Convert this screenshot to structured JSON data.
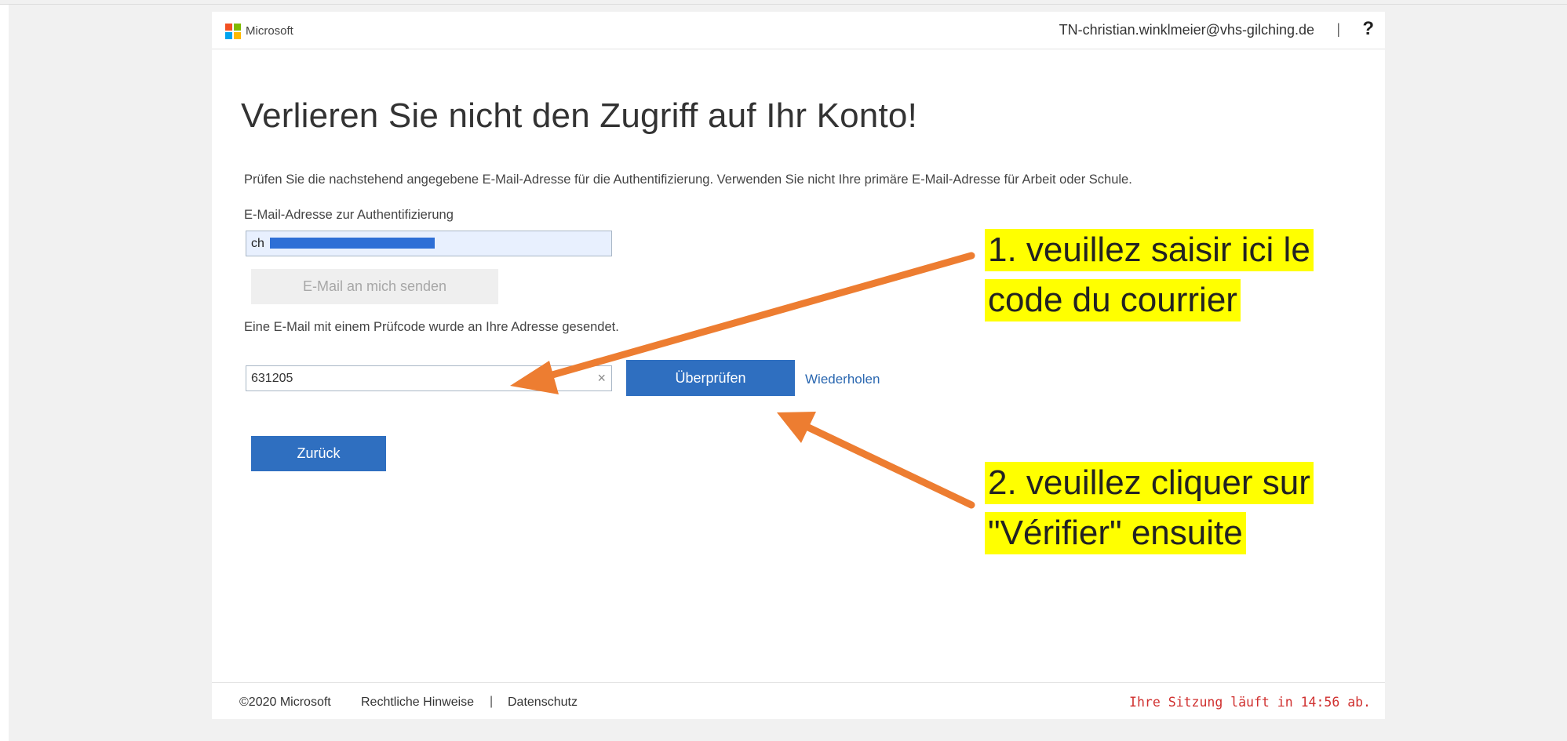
{
  "header": {
    "brand": "Microsoft",
    "user_email": "TN-christian.winklmeier@vhs-gilching.de",
    "separator": "|",
    "help_label": "?"
  },
  "main": {
    "title": "Verlieren Sie nicht den Zugriff auf Ihr Konto!",
    "description": "Prüfen Sie die nachstehend angegebene E-Mail-Adresse für die Authentifizierung. Verwenden Sie nicht Ihre primäre E-Mail-Adresse für Arbeit oder Schule.",
    "email_label": "E-Mail-Adresse zur Authentifizierung",
    "email_value_visible": "ch",
    "send_button": "E-Mail an mich senden",
    "sent_message": "Eine E-Mail mit einem Prüfcode wurde an Ihre Adresse gesendet.",
    "code_value": "631205",
    "clear_icon": "×",
    "verify_button": "Überprüfen",
    "retry_link": "Wiederholen",
    "back_button": "Zurück"
  },
  "footer": {
    "copyright": "©2020 Microsoft",
    "legal": "Rechtliche Hinweise",
    "separator": "|",
    "privacy": "Datenschutz",
    "session": "Ihre Sitzung läuft in 14:56 ab."
  },
  "annotations": {
    "note1_line1": "1. veuillez saisir ici le",
    "note1_line2": "code du courrier",
    "note2_line1": "2. veuillez cliquer sur",
    "note2_line2": "\"Vérifier\" ensuite",
    "highlight_color": "#ffff00",
    "arrow_color": "#ed7d31"
  },
  "colors": {
    "primary_button": "#2f6fc0",
    "link": "#2a67b0",
    "session_warning": "#d0302f"
  }
}
